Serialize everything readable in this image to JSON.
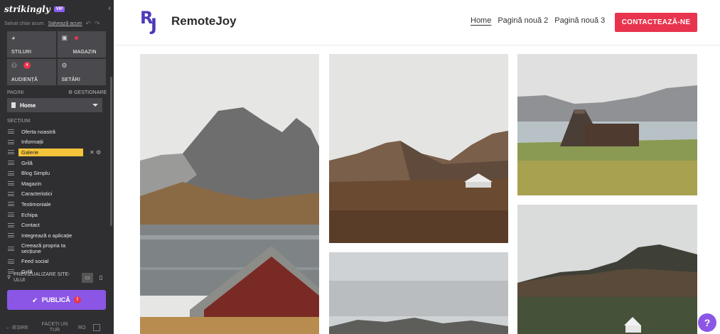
{
  "editor": {
    "brand": "strikingly",
    "vip": "VIP",
    "saved_text": "Salvat chiar acum.",
    "save_now": "Salvează acum",
    "tiles": [
      {
        "label": "STILURI",
        "icon": "palette-icon"
      },
      {
        "label": "MAGAZIN",
        "icon": "bag-icon"
      },
      {
        "label": "AUDIENȚĂ",
        "icon": "people-icon",
        "badge": "4"
      },
      {
        "label": "SETĂRI",
        "icon": "gear-icon"
      }
    ],
    "pages_label": "PAGINI",
    "manage_label": "GESTIONARE",
    "current_page": "Home",
    "sections_label": "SECȚIUNI",
    "sections": [
      "Oferta noastră",
      "Informații",
      "Galerie",
      "Grilă",
      "Blog Simplu",
      "Magazin",
      "Caracteristici",
      "Testimoniale",
      "Echipa",
      "Contact",
      "Integrează o aplicație",
      "Creează propria ta secțiune",
      "Feed social",
      "Grilă"
    ],
    "active_section": "Galerie",
    "preview_label": "PREVIZUALIZARE SITE-ULUI",
    "publish_label": "PUBLICĂ",
    "publish_badge": "!",
    "exit_label": "IEȘIRE",
    "tour_label": "FACEȚI UN TUR",
    "lang_label": "RO"
  },
  "site": {
    "logo_r": "R",
    "logo_j": "J",
    "name": "RemoteJoy",
    "nav": [
      "Home",
      "Pagină nouă 2",
      "Pagină nouă 3"
    ],
    "cta": "CONTACTEAZĂ-NE",
    "accent": "#e8344e",
    "logo_color": "#4b3ab8",
    "help": "?"
  }
}
